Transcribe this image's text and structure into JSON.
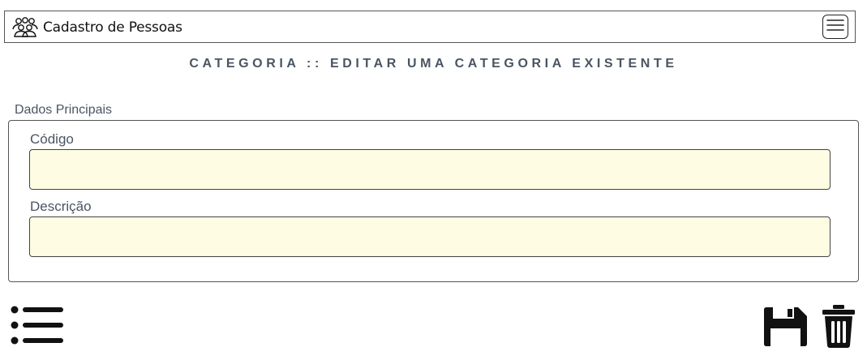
{
  "navbar": {
    "brand_label": "Cadastro de Pessoas",
    "brand_icon": "people-group-icon",
    "menu_icon": "hamburger-menu-icon"
  },
  "page": {
    "title": "CATEGORIA :: EDITAR UMA CATEGORIA EXISTENTE"
  },
  "form": {
    "section_legend": "Dados Principais",
    "fields": [
      {
        "label": "Código",
        "value": "",
        "placeholder": ""
      },
      {
        "label": "Descrição",
        "value": "",
        "placeholder": ""
      }
    ],
    "input_background": "#fefce2"
  },
  "actions": {
    "list_icon": "list-icon",
    "save_icon": "floppy-disk-save-icon",
    "delete_icon": "trash-delete-icon"
  },
  "colors": {
    "label_text": "#4a5563",
    "border": "#555555",
    "icon": "#111111"
  }
}
